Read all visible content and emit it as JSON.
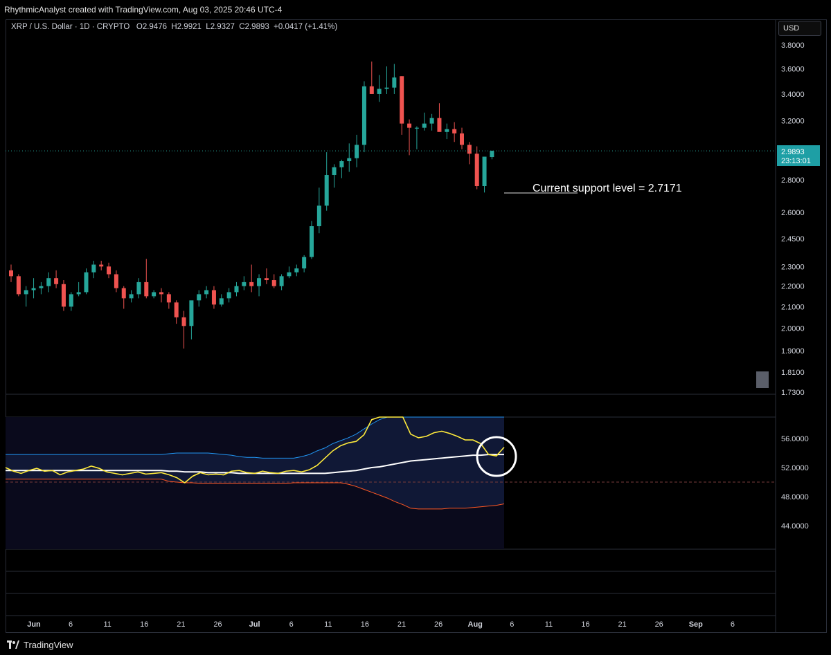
{
  "header": {
    "attribution": "RhythmicAnalyst created with TradingView.com, Aug 03, 2025 20:46 UTC-4"
  },
  "legend": {
    "symbol": "XRP / U.S. Dollar · 1D · CRYPTO",
    "open_label": "O",
    "open": "2.9476",
    "high_label": "H",
    "high": "2.9921",
    "low_label": "L",
    "low": "2.9327",
    "close_label": "C",
    "close": "2.9893",
    "change": "+0.0417 (+1.41%)"
  },
  "currency_button": "USD",
  "price_tag": {
    "price": "2.9893",
    "countdown": "23:13:01"
  },
  "annotation": {
    "text": "Current support level =  2.7171"
  },
  "footer": {
    "brand": "TradingView"
  },
  "colors": {
    "up": "#26a69a",
    "down": "#ef5350",
    "background": "#000000",
    "rsi_line": "#ffeb3b",
    "rsi_ma": "#ffffff",
    "bb_upper": "#2196f3",
    "bb_lower": "#ff5722",
    "band_fill": "#0c1124",
    "price_tag": "#2196a3"
  },
  "chart_data": [
    {
      "type": "candlestick",
      "title": "XRP / U.S. Dollar · 1D · CRYPTO",
      "scale": "log",
      "ylim": [
        1.7,
        3.9
      ],
      "y_ticks": [
        "3.8000",
        "3.6000",
        "3.4000",
        "3.2000",
        "2.8000",
        "2.6000",
        "2.4500",
        "2.3000",
        "2.2000",
        "2.1000",
        "2.0000",
        "1.9000",
        "1.8100",
        "1.7300"
      ],
      "x_ticks": [
        "Jun",
        "6",
        "11",
        "16",
        "21",
        "26",
        "Jul",
        "6",
        "11",
        "16",
        "21",
        "26",
        "Aug",
        "6",
        "11",
        "16",
        "21",
        "26",
        "Sep",
        "6"
      ],
      "last_price": 2.9893,
      "support_level": 2.7171,
      "candles": [
        {
          "o": 2.28,
          "h": 2.31,
          "l": 2.22,
          "c": 2.25
        },
        {
          "o": 2.25,
          "h": 2.26,
          "l": 2.15,
          "c": 2.16
        },
        {
          "o": 2.16,
          "h": 2.2,
          "l": 2.1,
          "c": 2.18
        },
        {
          "o": 2.18,
          "h": 2.24,
          "l": 2.14,
          "c": 2.19
        },
        {
          "o": 2.19,
          "h": 2.22,
          "l": 2.16,
          "c": 2.2
        },
        {
          "o": 2.2,
          "h": 2.27,
          "l": 2.17,
          "c": 2.24
        },
        {
          "o": 2.24,
          "h": 2.28,
          "l": 2.19,
          "c": 2.21
        },
        {
          "o": 2.21,
          "h": 2.23,
          "l": 2.08,
          "c": 2.1
        },
        {
          "o": 2.1,
          "h": 2.17,
          "l": 2.08,
          "c": 2.16
        },
        {
          "o": 2.16,
          "h": 2.22,
          "l": 2.15,
          "c": 2.17
        },
        {
          "o": 2.17,
          "h": 2.29,
          "l": 2.16,
          "c": 2.27
        },
        {
          "o": 2.27,
          "h": 2.33,
          "l": 2.24,
          "c": 2.31
        },
        {
          "o": 2.31,
          "h": 2.33,
          "l": 2.28,
          "c": 2.3
        },
        {
          "o": 2.3,
          "h": 2.32,
          "l": 2.24,
          "c": 2.26
        },
        {
          "o": 2.26,
          "h": 2.28,
          "l": 2.17,
          "c": 2.19
        },
        {
          "o": 2.19,
          "h": 2.2,
          "l": 2.09,
          "c": 2.14
        },
        {
          "o": 2.14,
          "h": 2.18,
          "l": 2.12,
          "c": 2.16
        },
        {
          "o": 2.16,
          "h": 2.24,
          "l": 2.14,
          "c": 2.22
        },
        {
          "o": 2.22,
          "h": 2.34,
          "l": 2.14,
          "c": 2.15
        },
        {
          "o": 2.15,
          "h": 2.18,
          "l": 2.14,
          "c": 2.17
        },
        {
          "o": 2.17,
          "h": 2.19,
          "l": 2.12,
          "c": 2.16
        },
        {
          "o": 2.16,
          "h": 2.17,
          "l": 2.09,
          "c": 2.12
        },
        {
          "o": 2.12,
          "h": 2.13,
          "l": 2.02,
          "c": 2.05
        },
        {
          "o": 2.05,
          "h": 2.08,
          "l": 1.91,
          "c": 2.01
        },
        {
          "o": 2.01,
          "h": 2.12,
          "l": 1.95,
          "c": 2.13
        },
        {
          "o": 2.13,
          "h": 2.18,
          "l": 2.1,
          "c": 2.16
        },
        {
          "o": 2.16,
          "h": 2.2,
          "l": 2.14,
          "c": 2.18
        },
        {
          "o": 2.18,
          "h": 2.2,
          "l": 2.09,
          "c": 2.11
        },
        {
          "o": 2.11,
          "h": 2.16,
          "l": 2.1,
          "c": 2.14
        },
        {
          "o": 2.14,
          "h": 2.19,
          "l": 2.12,
          "c": 2.17
        },
        {
          "o": 2.17,
          "h": 2.22,
          "l": 2.15,
          "c": 2.2
        },
        {
          "o": 2.2,
          "h": 2.25,
          "l": 2.18,
          "c": 2.22
        },
        {
          "o": 2.22,
          "h": 2.31,
          "l": 2.17,
          "c": 2.2
        },
        {
          "o": 2.2,
          "h": 2.26,
          "l": 2.15,
          "c": 2.24
        },
        {
          "o": 2.24,
          "h": 2.29,
          "l": 2.21,
          "c": 2.23
        },
        {
          "o": 2.23,
          "h": 2.26,
          "l": 2.19,
          "c": 2.2
        },
        {
          "o": 2.2,
          "h": 2.26,
          "l": 2.18,
          "c": 2.25
        },
        {
          "o": 2.25,
          "h": 2.3,
          "l": 2.24,
          "c": 2.27
        },
        {
          "o": 2.27,
          "h": 2.31,
          "l": 2.25,
          "c": 2.29
        },
        {
          "o": 2.29,
          "h": 2.36,
          "l": 2.27,
          "c": 2.35
        },
        {
          "o": 2.35,
          "h": 2.55,
          "l": 2.34,
          "c": 2.52
        },
        {
          "o": 2.52,
          "h": 2.75,
          "l": 2.48,
          "c": 2.64
        },
        {
          "o": 2.64,
          "h": 2.98,
          "l": 2.61,
          "c": 2.83
        },
        {
          "o": 2.83,
          "h": 2.9,
          "l": 2.75,
          "c": 2.88
        },
        {
          "o": 2.88,
          "h": 2.93,
          "l": 2.81,
          "c": 2.92
        },
        {
          "o": 2.92,
          "h": 3.04,
          "l": 2.85,
          "c": 2.94
        },
        {
          "o": 2.94,
          "h": 3.1,
          "l": 2.88,
          "c": 3.03
        },
        {
          "o": 3.03,
          "h": 3.5,
          "l": 2.98,
          "c": 3.46
        },
        {
          "o": 3.46,
          "h": 3.66,
          "l": 3.4,
          "c": 3.4
        },
        {
          "o": 3.4,
          "h": 3.55,
          "l": 3.34,
          "c": 3.44
        },
        {
          "o": 3.44,
          "h": 3.62,
          "l": 3.4,
          "c": 3.45
        },
        {
          "o": 3.45,
          "h": 3.64,
          "l": 3.4,
          "c": 3.53
        },
        {
          "o": 3.54,
          "h": 3.54,
          "l": 3.1,
          "c": 3.18
        },
        {
          "o": 3.18,
          "h": 3.21,
          "l": 2.96,
          "c": 3.15
        },
        {
          "o": 3.15,
          "h": 3.16,
          "l": 3.0,
          "c": 3.15
        },
        {
          "o": 3.15,
          "h": 3.26,
          "l": 3.13,
          "c": 3.18
        },
        {
          "o": 3.18,
          "h": 3.25,
          "l": 3.13,
          "c": 3.22
        },
        {
          "o": 3.22,
          "h": 3.33,
          "l": 3.14,
          "c": 3.12
        },
        {
          "o": 3.12,
          "h": 3.18,
          "l": 3.07,
          "c": 3.14
        },
        {
          "o": 3.14,
          "h": 3.19,
          "l": 3.05,
          "c": 3.11
        },
        {
          "o": 3.11,
          "h": 3.15,
          "l": 3.0,
          "c": 3.03
        },
        {
          "o": 3.03,
          "h": 3.05,
          "l": 2.9,
          "c": 2.97
        },
        {
          "o": 2.97,
          "h": 3.02,
          "l": 2.74,
          "c": 2.76
        },
        {
          "o": 2.76,
          "h": 2.95,
          "l": 2.72,
          "c": 2.95
        },
        {
          "o": 2.9476,
          "h": 2.9921,
          "l": 2.9327,
          "c": 2.9893
        }
      ]
    },
    {
      "type": "line",
      "y_ticks": [
        "56.0000",
        "52.0000",
        "48.0000",
        "44.0000"
      ],
      "ylim": [
        40,
        59.5
      ],
      "middle_line": 50,
      "series": [
        {
          "values": [
            52.0,
            51.5,
            51.2,
            51.6,
            51.9,
            51.5,
            51.6,
            51.0,
            51.4,
            51.6,
            51.8,
            52.2,
            51.9,
            51.4,
            51.2,
            51.0,
            51.2,
            51.4,
            51.1,
            51.2,
            51.3,
            51.0,
            50.6,
            49.9,
            50.8,
            51.3,
            51.0,
            51.1,
            51.0,
            51.5,
            51.6,
            51.3,
            51.2,
            51.5,
            51.3,
            51.2,
            51.5,
            51.6,
            51.4,
            51.7,
            52.3,
            53.3,
            54.3,
            55.0,
            55.4,
            55.6,
            56.5,
            58.6,
            59.2,
            59.3,
            59.4,
            59.5,
            56.6,
            56.1,
            56.3,
            56.8,
            57.0,
            56.7,
            56.3,
            55.8,
            55.8,
            55.3,
            53.8,
            53.6,
            54.8
          ]
        },
        {
          "values": [
            51.6,
            51.6,
            51.6,
            51.6,
            51.6,
            51.6,
            51.6,
            51.6,
            51.6,
            51.6,
            51.6,
            51.6,
            51.6,
            51.6,
            51.6,
            51.6,
            51.6,
            51.6,
            51.6,
            51.6,
            51.6,
            51.5,
            51.5,
            51.4,
            51.4,
            51.4,
            51.3,
            51.3,
            51.3,
            51.3,
            51.2,
            51.2,
            51.2,
            51.2,
            51.2,
            51.2,
            51.2,
            51.2,
            51.2,
            51.2,
            51.2,
            51.2,
            51.3,
            51.4,
            51.5,
            51.6,
            51.8,
            52.0,
            52.1,
            52.3,
            52.5,
            52.7,
            52.9,
            53.0,
            53.1,
            53.2,
            53.3,
            53.4,
            53.5,
            53.6,
            53.7,
            53.7,
            53.8,
            53.8,
            53.8
          ]
        },
        {
          "values": [
            53.8,
            53.8,
            53.8,
            53.8,
            53.8,
            53.8,
            53.8,
            53.8,
            53.8,
            53.8,
            53.8,
            53.8,
            53.8,
            53.8,
            53.8,
            53.8,
            53.8,
            53.8,
            53.8,
            53.8,
            53.8,
            53.9,
            54.0,
            54.0,
            54.0,
            54.0,
            54.0,
            53.9,
            53.8,
            53.7,
            53.5,
            53.4,
            53.4,
            53.3,
            53.3,
            53.3,
            53.3,
            53.3,
            53.5,
            53.8,
            54.3,
            54.7,
            55.3,
            55.7,
            56.1,
            56.6,
            57.3,
            58.0,
            58.6,
            59.2,
            59.6,
            60.0,
            60.2,
            60.4,
            60.5,
            60.5,
            60.5,
            60.5,
            60.5,
            60.5,
            60.5,
            60.5,
            60.5,
            60.5,
            60.5
          ]
        },
        {
          "values": [
            50.4,
            50.4,
            50.4,
            50.4,
            50.4,
            50.4,
            50.4,
            50.4,
            50.4,
            50.4,
            50.4,
            50.4,
            50.4,
            50.4,
            50.4,
            50.4,
            50.4,
            50.4,
            50.4,
            50.4,
            50.4,
            50.1,
            50.0,
            49.9,
            49.9,
            49.8,
            49.8,
            49.8,
            49.8,
            49.8,
            49.8,
            49.8,
            49.8,
            49.8,
            49.8,
            49.8,
            49.8,
            49.9,
            49.9,
            49.9,
            49.9,
            49.9,
            49.9,
            49.9,
            49.7,
            49.4,
            49.0,
            48.6,
            48.2,
            47.8,
            47.3,
            46.9,
            46.4,
            46.3,
            46.3,
            46.3,
            46.3,
            46.4,
            46.4,
            46.4,
            46.5,
            46.6,
            46.7,
            46.8,
            47.0
          ]
        }
      ]
    }
  ]
}
